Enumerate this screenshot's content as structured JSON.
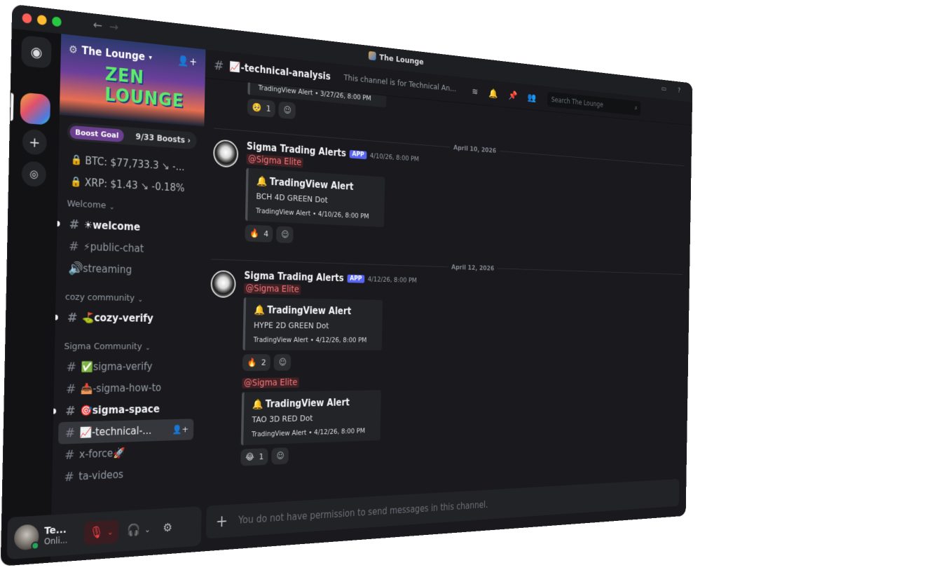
{
  "window": {
    "title": "The Lounge"
  },
  "nav": {
    "back": "←",
    "forward": "→"
  },
  "server": {
    "name": "The Lounge",
    "banner_text": "ZEN LOUNGE",
    "boost": {
      "label": "Boost Goal",
      "count": "9/33 Boosts ›"
    }
  },
  "stats": [
    {
      "label": "BTC: $77,733.3 ↘ -..."
    },
    {
      "label": "XRP: $1.43 ↘ -0.18%"
    }
  ],
  "categories": {
    "welcome": "Welcome",
    "cozy": "cozy community",
    "sigma": "Sigma Community"
  },
  "channels": {
    "welcome": "☀welcome",
    "public_chat": "⚡public-chat",
    "streaming": "streaming",
    "cozy_verify": "⛳cozy-verify",
    "sigma_verify": "✅sigma-verify",
    "sigma_how_to": "📥-sigma-how-to",
    "sigma_space": "🎯sigma-space",
    "technical": "📈-technical-...",
    "x_force": "x-force🚀",
    "ta_videos": "ta-videos"
  },
  "header": {
    "channel": "📈-technical-analysis",
    "topic": "This channel is for Technical An...",
    "search_placeholder": "Search The Lounge"
  },
  "partial": {
    "footer": "TradingView Alert • 3/27/26, 8:00 PM",
    "reaction_emoji": "🥺",
    "reaction_count": "1"
  },
  "messages": [
    {
      "date": "April 10, 2026",
      "author": "Sigma Trading Alerts",
      "badge": "APP",
      "time": "4/10/26, 8:00 PM",
      "mention": "@Sigma Elite",
      "embed_title": "TradingView Alert",
      "embed_desc": "BCH 4D GREEN Dot",
      "embed_footer": "TradingView Alert • 4/10/26, 8:00 PM",
      "reaction_emoji": "🔥",
      "reaction_count": "4"
    },
    {
      "date": "April 12, 2026",
      "author": "Sigma Trading Alerts",
      "badge": "APP",
      "time": "4/12/26, 8:00 PM",
      "mention": "@Sigma Elite",
      "embed_title": "TradingView Alert",
      "embed_desc": "HYPE 2D GREEN Dot",
      "embed_footer": "TradingView Alert • 4/12/26, 8:00 PM",
      "reaction_emoji": "🔥",
      "reaction_count": "2"
    },
    {
      "mention": "@Sigma Elite",
      "embed_title": "TradingView Alert",
      "embed_desc": "TAO 3D RED Dot",
      "embed_footer": "TradingView Alert • 4/12/26, 8:00 PM",
      "reaction_emoji": "😂",
      "reaction_count": "1"
    }
  ],
  "composer": {
    "placeholder": "You do not have permission to send messages in this channel."
  },
  "user": {
    "name": "Te...",
    "status": "Onli..."
  },
  "colors": {
    "accent": "#5865f2",
    "mention": "#f6787b",
    "online": "#23a55a",
    "muted_mic": "#f23f43"
  }
}
